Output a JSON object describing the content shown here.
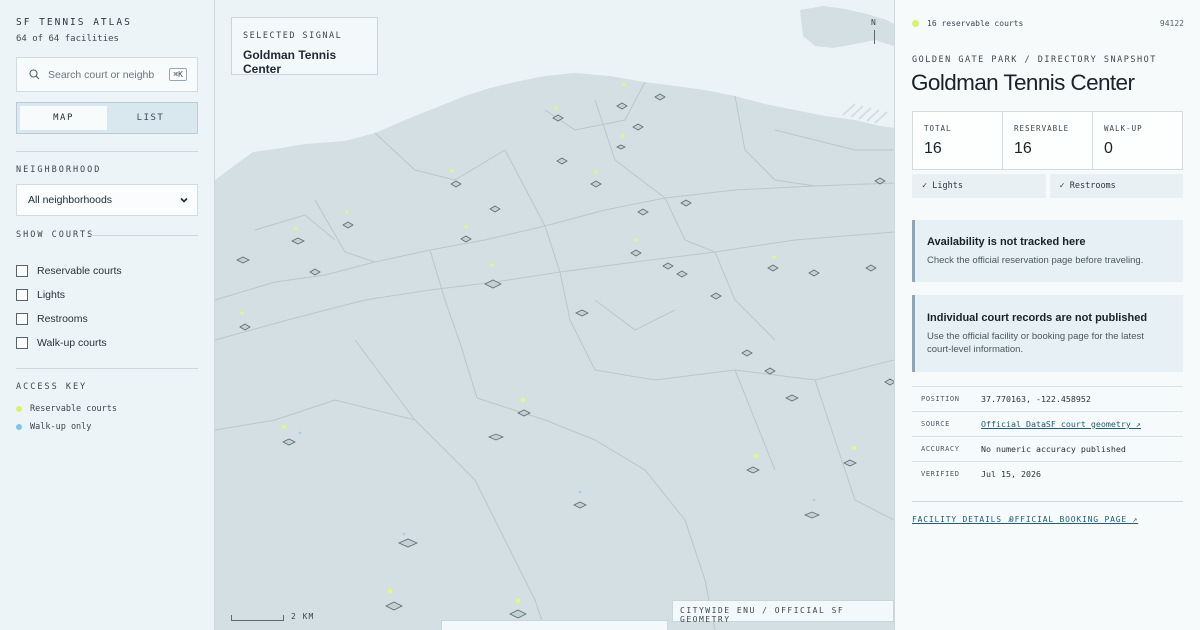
{
  "sidebar": {
    "brand": "SF TENNIS ATLAS",
    "facility_count": "64 of 64 facilities",
    "search": {
      "placeholder": "Search court or neighb",
      "shortcut": "⌘K"
    },
    "view_toggle": {
      "map_label": "MAP",
      "list_label": "LIST",
      "active": "map"
    },
    "neighborhood": {
      "label": "NEIGHBORHOOD",
      "selected": "All neighborhoods"
    },
    "show_courts": {
      "label": "SHOW COURTS",
      "filters": [
        {
          "label": "Reservable courts",
          "checked": false
        },
        {
          "label": "Lights",
          "checked": false
        },
        {
          "label": "Restrooms",
          "checked": false
        },
        {
          "label": "Walk-up courts",
          "checked": false
        }
      ]
    },
    "access_key": {
      "label": "ACCESS KEY",
      "items": [
        {
          "label": "Reservable courts",
          "color": "#d8f26a"
        },
        {
          "label": "Walk-up only",
          "color": "#7ac9e6"
        }
      ]
    }
  },
  "map": {
    "selected_signal": {
      "label": "SELECTED SIGNAL",
      "name": "Goldman Tennis Center"
    },
    "compass": "N",
    "scale": "2 KM",
    "geometry_label": "CITYWIDE ENU / OFFICIAL SF GEOMETRY",
    "colors": {
      "land": "#d3dfe2",
      "water": "#ecf3f6",
      "district_line": "#b8c8ce",
      "reservable": "#d8f26a",
      "walkup": "#7ac9e6"
    }
  },
  "panel": {
    "summary": {
      "dot_color": "#d8f26a",
      "text": "16 reservable courts",
      "zip": "94122"
    },
    "eyebrow": "GOLDEN GATE PARK / DIRECTORY SNAPSHOT",
    "title": "Goldman Tennis Center",
    "stats": [
      {
        "label": "TOTAL",
        "value": "16"
      },
      {
        "label": "RESERVABLE",
        "value": "16"
      },
      {
        "label": "WALK-UP",
        "value": "0"
      }
    ],
    "amenities": [
      "✓ Lights",
      "✓ Restrooms"
    ],
    "notices": [
      {
        "title": "Availability is not tracked here",
        "body": "Check the official reservation page before traveling."
      },
      {
        "title": "Individual court records are not published",
        "body": "Use the official facility or booking page for the latest court-level information."
      }
    ],
    "meta": [
      {
        "key": "POSITION",
        "value": "37.770163, -122.458952",
        "link": false
      },
      {
        "key": "SOURCE",
        "value": "Official DataSF court geometry ↗",
        "link": true
      },
      {
        "key": "ACCURACY",
        "value": "No numeric accuracy published",
        "link": false
      },
      {
        "key": "VERIFIED",
        "value": "Jul 15, 2026",
        "link": false
      }
    ],
    "links": {
      "facility_details": "FACILITY DETAILS ↗",
      "official_booking": "OFFICIAL BOOKING PAGE ↗"
    }
  }
}
